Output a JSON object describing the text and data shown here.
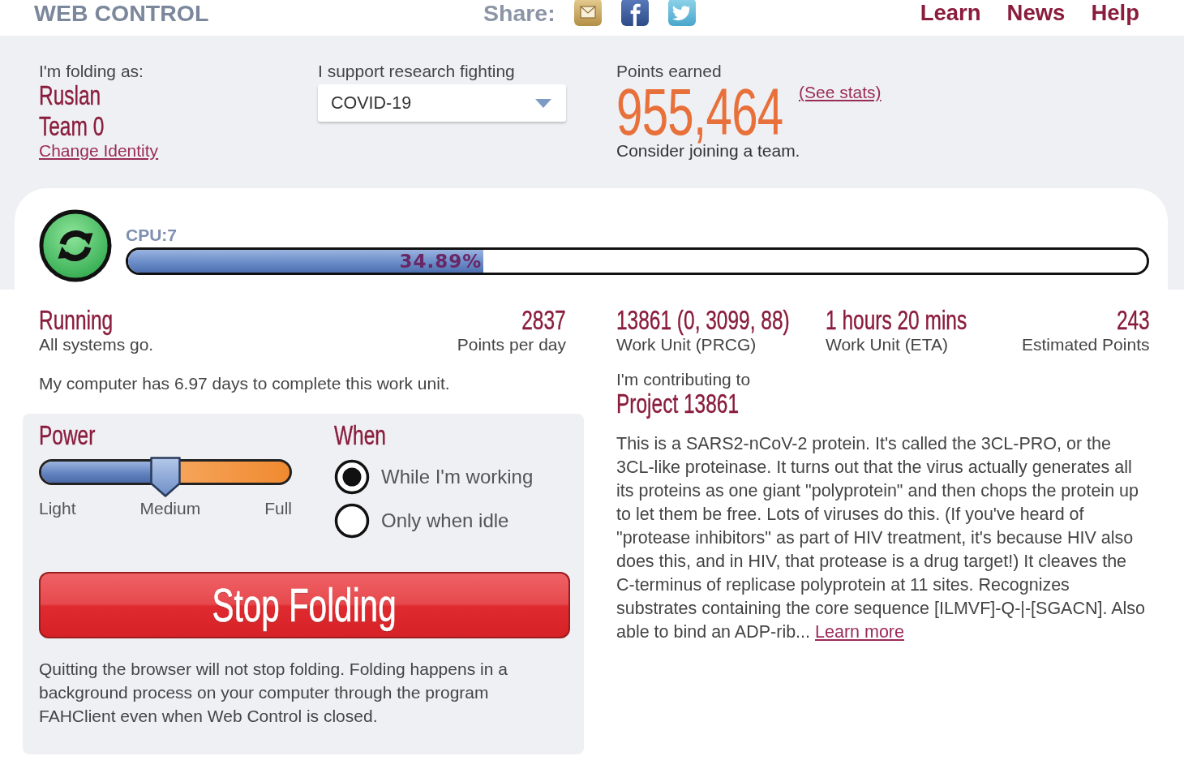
{
  "header": {
    "title": "WEB CONTROL",
    "share_label": "Share:",
    "nav": [
      "Learn",
      "News",
      "Help"
    ]
  },
  "identity": {
    "label": "I'm folding as:",
    "name": "Ruslan",
    "team": "Team 0",
    "link": "Change Identity"
  },
  "cause": {
    "label": "I support research fighting",
    "value": "COVID-19"
  },
  "points": {
    "label": "Points earned",
    "value": "955,464",
    "link": "(See stats)",
    "note": "Consider joining a team."
  },
  "progress": {
    "label": "CPU:7",
    "level": 0.3489,
    "reading": "34.89%"
  },
  "status": {
    "state": "Running",
    "caption": "All systems go.",
    "points_per_day": "2837",
    "points_per_day_caption": "Points per day",
    "deadline": "My computer has 6.97 days to complete this work unit."
  },
  "work_unit": [
    {
      "value": "13861 (0, 3099, 88)",
      "caption": "Work Unit (PRCG)"
    },
    {
      "value": "1 hours 20 mins",
      "caption": "Work Unit (ETA)"
    },
    {
      "value": "243",
      "caption": "Estimated Points"
    }
  ],
  "power": {
    "title": "Power",
    "level": 0.5,
    "labels": [
      "Light",
      "Medium",
      "Full"
    ]
  },
  "when": {
    "title": "When",
    "options": [
      {
        "label": "While I'm working",
        "selected": true
      },
      {
        "label": "Only when idle",
        "selected": false
      }
    ]
  },
  "stop_button": "Stop Folding",
  "note": "Quitting the browser will not stop folding. Folding happens in a background process on your computer through the program FAHClient even when Web Control is closed.",
  "project": {
    "label": "I'm contributing to",
    "title": "Project 13861",
    "description": "This is a SARS2-nCoV-2 protein. It's called the 3CL-PRO, or the 3CL-like proteinase. It turns out that the virus actually generates all its proteins as one giant \"polyprotein\" and then chops the protein up to let them be free. Lots of viruses do this. (If you've heard of \"protease inhibitors\" as part of HIV treatment, it's because HIV also does this, and in HIV, that protease is a drug target!) It cleaves the C-terminus of replicase polyprotein at 11 sites. Recognizes substrates containing the core sequence [ILMVF]-Q-|-[SGACN]. Also able to bind an ADP-rib...",
    "link": "Learn more"
  }
}
